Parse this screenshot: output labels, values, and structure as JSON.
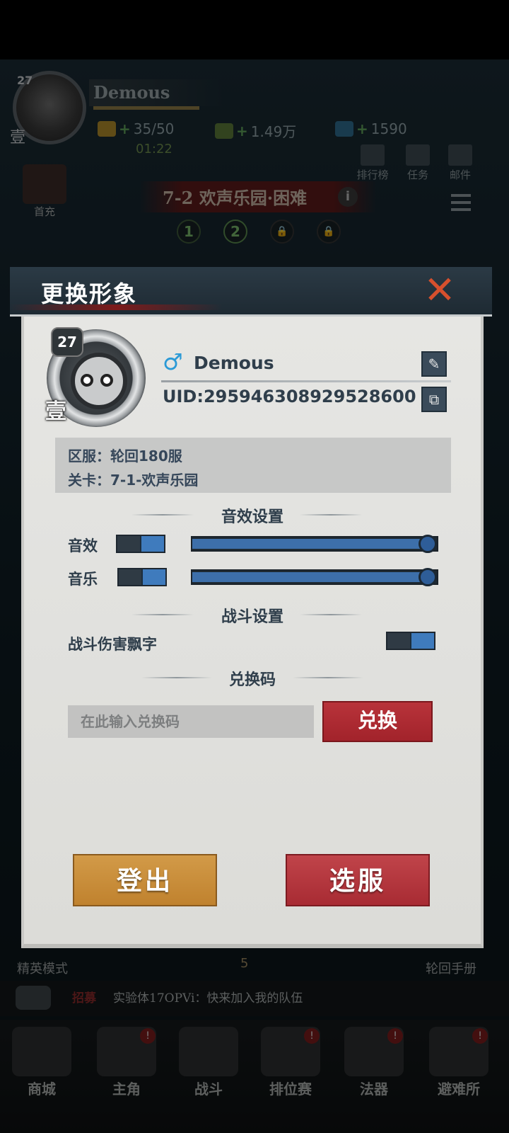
{
  "hud": {
    "player_level": "27",
    "player_rank": "壹",
    "player_name": "Demous",
    "energy": "35/50",
    "energy_timer": "01:22",
    "gold": "1.49万",
    "gems": "1590",
    "buttons": {
      "ranking": "排行榜",
      "tasks": "任务",
      "mail": "邮件",
      "first_charge": "首充"
    },
    "stage_title": "7-2 欢声乐园·困难",
    "stage_nodes": [
      "1",
      "2"
    ],
    "elite_mode": "精英模式",
    "cycle_manual": "轮回手册",
    "energy_cost": "5"
  },
  "chat": {
    "tag": "招募",
    "message": "实验体17OPVi：快来加入我的队伍"
  },
  "bottom_nav": [
    {
      "label": "商城",
      "badge": ""
    },
    {
      "label": "主角",
      "badge": "!"
    },
    {
      "label": "战斗",
      "badge": ""
    },
    {
      "label": "排位赛",
      "badge": "!"
    },
    {
      "label": "法器",
      "badge": "!"
    },
    {
      "label": "避难所",
      "badge": "!"
    }
  ],
  "modal": {
    "title": "更换形象",
    "close_icon": "close-icon",
    "profile": {
      "level": "27",
      "rank": "壹",
      "gender_symbol": "♂",
      "name": "Demous",
      "uid": "UID:295946308929528600",
      "edit_icon": "✎",
      "copy_icon": "⧉"
    },
    "server": "区服：轮回180服",
    "stage": "关卡：7-1-欢声乐园",
    "audio_section": "音效设置",
    "sound_effects_label": "音效",
    "sound_effects_on": true,
    "sound_effects_volume": 1.0,
    "music_label": "音乐",
    "music_on": true,
    "music_volume": 1.0,
    "battle_section": "战斗设置",
    "damage_text_label": "战斗伤害飘字",
    "damage_text_on": true,
    "redeem_section": "兑换码",
    "redeem_placeholder": "在此输入兑换码",
    "redeem_button": "兑换",
    "logout_button": "登出",
    "select_server_button": "选服"
  },
  "colors": {
    "accent_blue": "#3d6faa",
    "danger_red": "#a82b33",
    "logout_orange": "#c98c38",
    "paper": "#e2e2df",
    "text_dark": "#2f3e4b"
  }
}
